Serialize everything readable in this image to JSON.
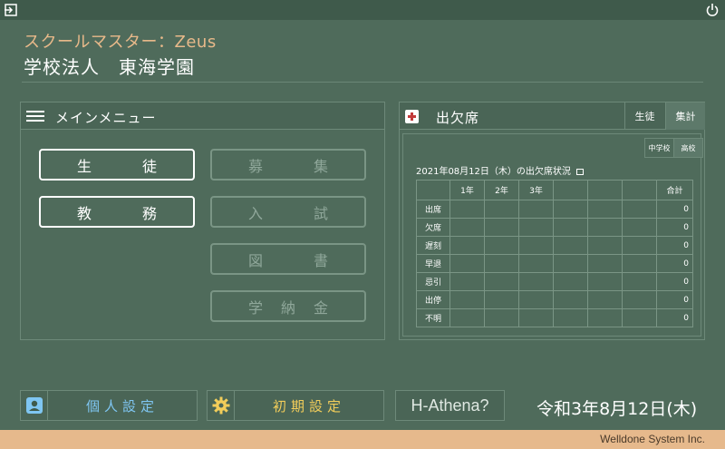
{
  "header": {
    "app_title": "スクールマスター：Zeus",
    "school_name": "学校法人　東海学園"
  },
  "main_menu": {
    "title": "メインメニュー",
    "buttons": [
      {
        "label": "生　徒",
        "enabled": true
      },
      {
        "label": "募　集",
        "enabled": false
      },
      {
        "label": "教　務",
        "enabled": true
      },
      {
        "label": "入　試",
        "enabled": false
      },
      {
        "label": "図　書",
        "enabled": false
      },
      {
        "label": "学納金",
        "enabled": false
      }
    ]
  },
  "attendance": {
    "title": "出欠席",
    "tabs": [
      {
        "label": "生徒",
        "active": false
      },
      {
        "label": "集計",
        "active": true
      }
    ],
    "school_tabs": [
      {
        "label": "中学校",
        "active": false
      },
      {
        "label": "高校",
        "active": true
      }
    ],
    "caption": "2021年08月12日（木）の出欠席状況",
    "columns": [
      "1年",
      "2年",
      "3年",
      "",
      "",
      "",
      "合計"
    ],
    "rows": [
      {
        "label": "出席",
        "total": "0"
      },
      {
        "label": "欠席",
        "total": "0"
      },
      {
        "label": "遅刻",
        "total": "0"
      },
      {
        "label": "早退",
        "total": "0"
      },
      {
        "label": "忌引",
        "total": "0"
      },
      {
        "label": "出停",
        "total": "0"
      },
      {
        "label": "不明",
        "total": "0"
      }
    ]
  },
  "footer": {
    "personal_settings": "個人設定",
    "initial_settings": "初期設定",
    "athena": "H-Athena?",
    "date": "令和3年8月12日(木)",
    "company": "Welldone System Inc."
  },
  "colors": {
    "background": "#4f6b5b",
    "app_title": "#e8b98a",
    "personal_label": "#7fc6f2",
    "initial_label": "#f2cd5a",
    "bottom_bar": "#e6b98c"
  }
}
